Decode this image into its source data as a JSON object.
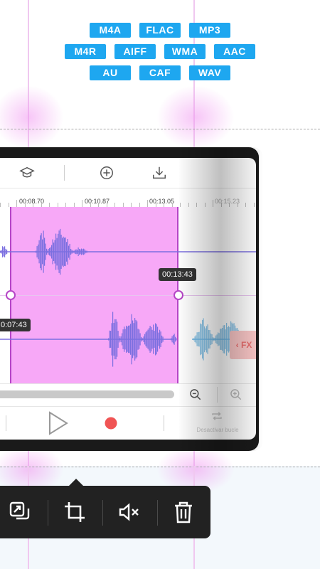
{
  "formats": {
    "row1": [
      "M4A",
      "FLAC",
      "MP3"
    ],
    "row2": [
      "M4R",
      "AIFF",
      "WMA",
      "AAC"
    ],
    "row3": [
      "AU",
      "CAF",
      "WAV"
    ]
  },
  "ruler": {
    "labels": [
      "00:08.70",
      "00:10.87",
      "00:13.05",
      "00:15.23"
    ]
  },
  "selection": {
    "end_time": "00:13:43",
    "start_time": "0:07:43"
  },
  "fx_label": "FX",
  "transport": {
    "loop_label": "Desactivar bucle"
  },
  "colors": {
    "format_badge": "#1ea7f0",
    "selection": "#f7a8f7",
    "selection_border": "#b545c6",
    "waveform": "#7b6fe0",
    "waveform_light": "#6fb8e6",
    "record": "#f05454",
    "editbar": "#222222"
  },
  "icons": {
    "toolbar": [
      "graduation-cap-icon",
      "add-circle-icon",
      "download-icon"
    ],
    "editbar": [
      "copy-icon",
      "crop-icon",
      "mute-icon",
      "trash-icon"
    ]
  }
}
